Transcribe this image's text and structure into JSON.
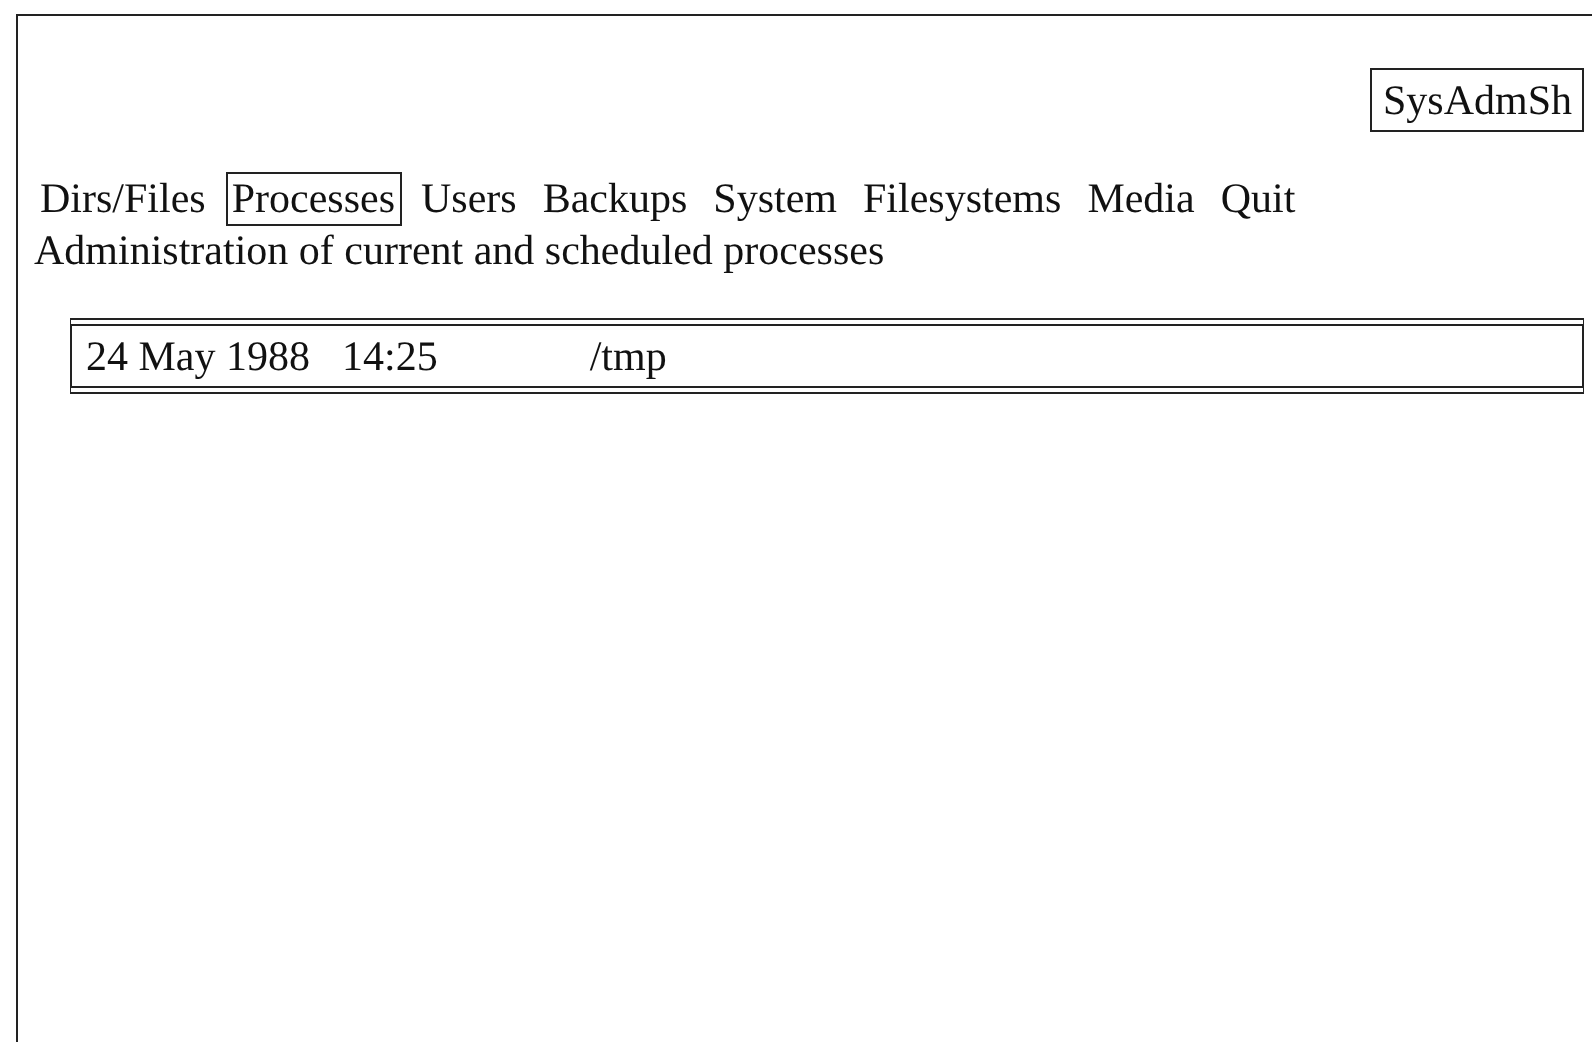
{
  "title": "SysAdmSh",
  "menu": [
    {
      "label": "Dirs/Files",
      "selected": false
    },
    {
      "label": "Processes",
      "selected": true
    },
    {
      "label": "Users",
      "selected": false
    },
    {
      "label": "Backups",
      "selected": false
    },
    {
      "label": "System",
      "selected": false
    },
    {
      "label": "Filesystems",
      "selected": false
    },
    {
      "label": "Media",
      "selected": false
    },
    {
      "label": "Quit",
      "selected": false
    }
  ],
  "description": "Administration of current and scheduled processes",
  "status": {
    "date": "24 May 1988",
    "time": "14:25",
    "directory": "/tmp"
  }
}
